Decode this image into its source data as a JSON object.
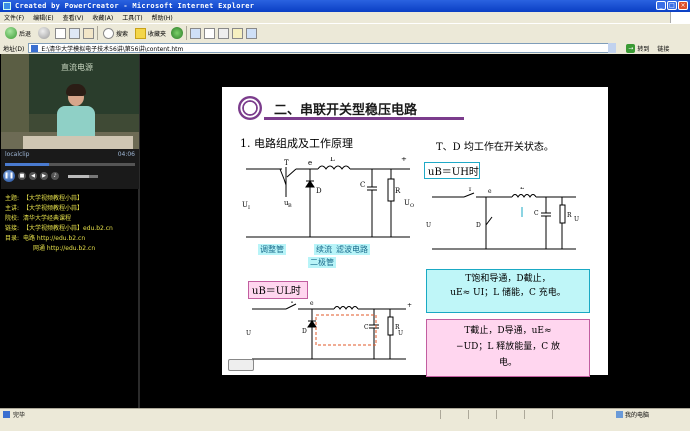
{
  "window": {
    "title": "Created by PowerCreator - Microsoft Internet Explorer"
  },
  "menu": [
    "文件(F)",
    "编辑(E)",
    "查看(V)",
    "收藏(A)",
    "工具(T)",
    "帮助(H)"
  ],
  "toolbar": {
    "back": "后退",
    "search": "搜索",
    "favorites": "收藏夹"
  },
  "address": {
    "label": "地址(D)",
    "value": "E:\\清华大学模拟电子技术56讲\\第56讲\\content.htm",
    "go": "转到",
    "links": "链接"
  },
  "player": {
    "label": "localclip",
    "time": "04:06",
    "progress_fraction": 0.34,
    "volume_fraction": 0.7
  },
  "info": [
    {
      "k": "主题:",
      "v": "【大学视频教程小蒜】"
    },
    {
      "k": "主讲:",
      "v": "【大学视频教程小蒜】"
    },
    {
      "k": "院校:",
      "v": "清华大学经典课程"
    },
    {
      "k": "链接:",
      "v": "【大学视频教程小蒜】edu.b2.cn"
    },
    {
      "k": "目录:",
      "v": "电路 http://edu.b2.cn"
    },
    {
      "k": "",
      "v": "网通 http://edu.b2.cn"
    }
  ],
  "video": {
    "chalk": "直流电源"
  },
  "slide": {
    "title": "二、串联开关型稳压电路",
    "section1": "1. 电路组成及工作原理",
    "section2": "T、D 均工作在开关状态。",
    "tag_uh": "uB＝UH时",
    "tag_ul": "uB＝UL时",
    "labels": {
      "tiaozheng": "调整管",
      "xuliu": "续流",
      "erjiguan": "二极管",
      "lvbo": "滤波电路"
    },
    "box_cyan_line1": "T饱和导通，D截止，",
    "box_cyan_line2": "uE≈ UI；L 储能，C 充电。",
    "box_pink_line1": "T截止，D导通，uE≈",
    "box_pink_line2": "−UD；L 释放能量，C 放",
    "box_pink_line3": "电。"
  },
  "status": {
    "done": "完毕",
    "zone": "我的电脑"
  }
}
